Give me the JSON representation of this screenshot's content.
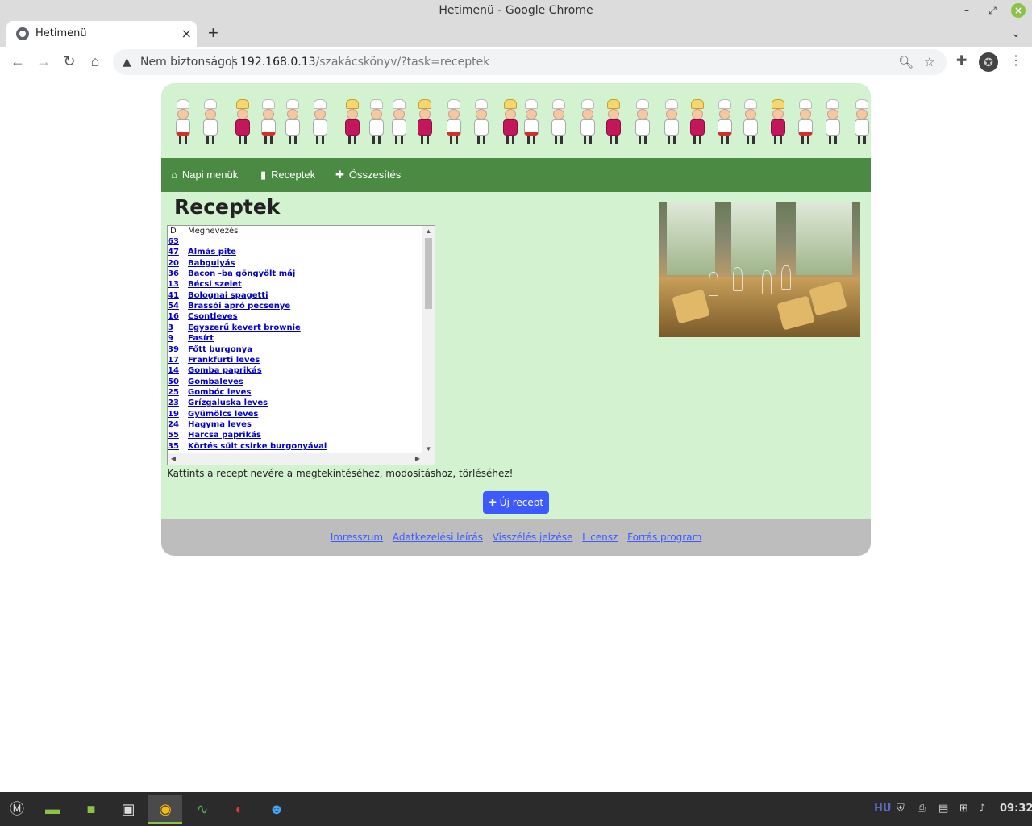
{
  "window": {
    "title": "Hetimenü - Google Chrome"
  },
  "tab": {
    "title": "Hetimenü"
  },
  "address_bar": {
    "security": "Nem biztonságos",
    "host": "192.168.0.13",
    "path": "/szakácskönyv/?task=receptek"
  },
  "nav": {
    "items": [
      {
        "icon": "home-icon",
        "label": "Napi menük"
      },
      {
        "icon": "book-icon",
        "label": "Receptek"
      },
      {
        "icon": "plus-icon",
        "label": "Összesítés"
      }
    ]
  },
  "page": {
    "heading": "Receptek",
    "table_headers": {
      "id": "ID",
      "name": "Megnevezés"
    },
    "recipes": [
      {
        "id": "63",
        "name": ""
      },
      {
        "id": "47",
        "name": "Almás pite"
      },
      {
        "id": "20",
        "name": "Babgulyás"
      },
      {
        "id": "36",
        "name": "Bacon -ba göngyölt máj"
      },
      {
        "id": "13",
        "name": "Bécsi szelet"
      },
      {
        "id": "41",
        "name": "Bolognai spagetti"
      },
      {
        "id": "54",
        "name": "Brassói apró pecsenye"
      },
      {
        "id": "16",
        "name": "Csontleves"
      },
      {
        "id": "3",
        "name": "Egyszerű kevert brownie"
      },
      {
        "id": "9",
        "name": "Fasírt"
      },
      {
        "id": "39",
        "name": "Főtt burgonya"
      },
      {
        "id": "17",
        "name": "Frankfurti leves"
      },
      {
        "id": "14",
        "name": "Gomba paprikás"
      },
      {
        "id": "50",
        "name": "Gombaleves"
      },
      {
        "id": "25",
        "name": "Gombóc leves"
      },
      {
        "id": "23",
        "name": "Grízgaluska leves"
      },
      {
        "id": "19",
        "name": "Gyümölcs leves"
      },
      {
        "id": "24",
        "name": "Hagyma leves"
      },
      {
        "id": "55",
        "name": "Harcsa paprikás"
      },
      {
        "id": "35",
        "name": "Körtés sült csirke burgonyával"
      }
    ],
    "hint": "Kattints a recept nevére a megtekintéséhez, modosításhoz, törléséhez!",
    "new_button": "Új recept"
  },
  "footer": {
    "links": [
      "Imresszum",
      "Adatkezelési leírás",
      "Visszélés jelzése",
      "Licensz",
      "Forrás program"
    ]
  },
  "taskbar": {
    "lang": "HU",
    "clock": "09:32"
  }
}
